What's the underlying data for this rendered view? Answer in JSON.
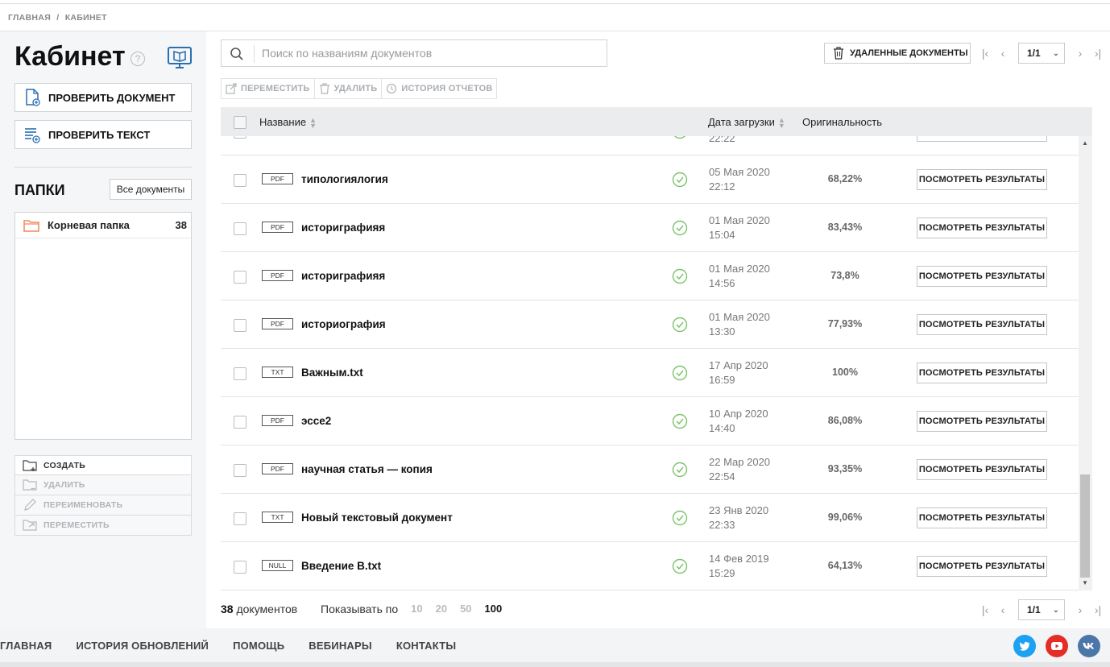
{
  "breadcrumb": [
    "ГЛАВНАЯ",
    "/",
    "КАБИНЕТ"
  ],
  "sidebar": {
    "title": "Кабинет",
    "help": "?",
    "check_document": "ПРОВЕРИТЬ ДОКУМЕНТ",
    "check_text": "ПРОВЕРИТЬ ТЕКСТ",
    "folders_title": "ПАПКИ",
    "all_documents": "Все документы",
    "folder": {
      "name": "Корневая папка",
      "count": "38"
    },
    "actions": {
      "create": "СОЗДАТЬ",
      "delete": "УДАЛИТЬ",
      "rename": "ПЕРЕИМЕНОВАТЬ",
      "move": "ПЕРЕМЕСТИТЬ"
    }
  },
  "search": {
    "placeholder": "Поиск по названиям документов"
  },
  "deleted_documents": "УДАЛЕННЫЕ ДОКУМЕНТЫ",
  "pager": {
    "value": "1/1"
  },
  "toolbar": {
    "move": "ПЕРЕМЕСТИТЬ",
    "delete": "УДАЛИТЬ",
    "history": "ИСТОРИЯ ОТЧЕТОВ"
  },
  "table": {
    "headers": {
      "name": "Название",
      "date": "Дата загрузки",
      "originality": "Оригинальность"
    },
    "partial_row": {
      "time": "22:22"
    },
    "rows": [
      {
        "type": "PDF",
        "name": "типологиялогия",
        "date": "05 Мая 2020",
        "time": "22:12",
        "originality": "68,22%",
        "action": "ПОСМОТРЕТЬ РЕЗУЛЬТАТЫ"
      },
      {
        "type": "PDF",
        "name": "историграфияя",
        "date": "01 Мая 2020",
        "time": "15:04",
        "originality": "83,43%",
        "action": "ПОСМОТРЕТЬ РЕЗУЛЬТАТЫ"
      },
      {
        "type": "PDF",
        "name": "историграфияя",
        "date": "01 Мая 2020",
        "time": "14:56",
        "originality": "73,8%",
        "action": "ПОСМОТРЕТЬ РЕЗУЛЬТАТЫ"
      },
      {
        "type": "PDF",
        "name": "историография",
        "date": "01 Мая 2020",
        "time": "13:30",
        "originality": "77,93%",
        "action": "ПОСМОТРЕТЬ РЕЗУЛЬТАТЫ"
      },
      {
        "type": "TXT",
        "name": "Важным.txt",
        "date": "17 Апр 2020",
        "time": "16:59",
        "originality": "100%",
        "action": "ПОСМОТРЕТЬ РЕЗУЛЬТАТЫ"
      },
      {
        "type": "PDF",
        "name": "эссе2",
        "date": "10 Апр 2020",
        "time": "14:40",
        "originality": "86,08%",
        "action": "ПОСМОТРЕТЬ РЕЗУЛЬТАТЫ"
      },
      {
        "type": "PDF",
        "name": "научная статья — копия",
        "date": "22 Мар 2020",
        "time": "22:54",
        "originality": "93,35%",
        "action": "ПОСМОТРЕТЬ РЕЗУЛЬТАТЫ"
      },
      {
        "type": "TXT",
        "name": "Новый текстовый документ",
        "date": "23 Янв 2020",
        "time": "22:33",
        "originality": "99,06%",
        "action": "ПОСМОТРЕТЬ РЕЗУЛЬТАТЫ"
      },
      {
        "type": "NULL",
        "name": "Введение В.txt",
        "date": "14 Фев 2019",
        "time": "15:29",
        "originality": "64,13%",
        "action": "ПОСМОТРЕТЬ РЕЗУЛЬТАТЫ"
      }
    ]
  },
  "bottom": {
    "count_number": "38",
    "count_label": "документов",
    "show_by_label": "Показывать по",
    "page_sizes": [
      "10",
      "20",
      "50",
      "100"
    ],
    "active_page_size": "100"
  },
  "footer": {
    "links": [
      "ГЛАВНАЯ",
      "ИСТОРИЯ ОБНОВЛЕНИЙ",
      "ПОМОЩЬ",
      "ВЕБИНАРЫ",
      "КОНТАКТЫ"
    ],
    "social": [
      "twitter-icon",
      "youtube-icon",
      "vk-icon"
    ]
  },
  "colors": {
    "ok_green": "#7cc36a",
    "folder_orange": "#f0885a",
    "accent_blue": "#2a6fb0",
    "twitter": "#1da1f2",
    "youtube": "#e52d27",
    "vk": "#4a76a8"
  }
}
